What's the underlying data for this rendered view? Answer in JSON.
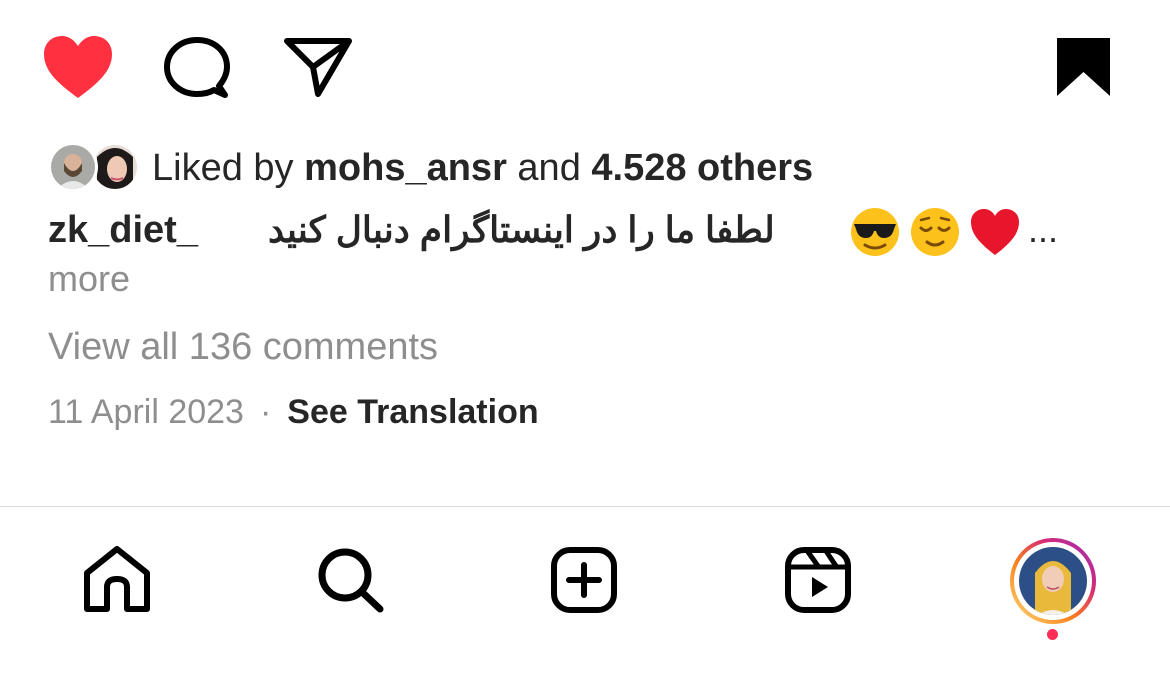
{
  "actions": {
    "like_icon": "heart-filled-icon",
    "comment_icon": "comment-bubble-icon",
    "share_icon": "paper-plane-icon",
    "save_icon": "bookmark-filled-icon",
    "like_color": "#ff3040"
  },
  "likes": {
    "prefix": "Liked by",
    "user": "mohs_ansr",
    "conjunction": "and",
    "others": "4.528 others"
  },
  "caption": {
    "username": "zk_diet_",
    "text": "لطفا ما را در اینستاگرام دنبال کنید",
    "emojis": [
      "sunglasses-face-emoji",
      "relieved-face-emoji",
      "red-heart-emoji"
    ],
    "ellipsis": "...",
    "more_label": "more"
  },
  "comments": {
    "view_all_label": "View all 136 comments"
  },
  "meta": {
    "date": "11 April 2023",
    "separator": "·",
    "see_translation": "See Translation"
  },
  "tabbar": {
    "items": [
      "home-icon",
      "search-icon",
      "create-post-icon",
      "reels-icon",
      "profile-avatar"
    ],
    "notification_dot_color": "#ff2d55"
  }
}
